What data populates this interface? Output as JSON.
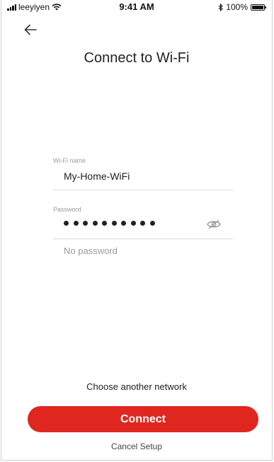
{
  "status_bar": {
    "carrier": "leeyiyen",
    "time": "9:41 AM",
    "battery": "100%",
    "icons": [
      "signal-icon",
      "wifi-icon",
      "bluetooth-icon",
      "battery-icon"
    ]
  },
  "header": {
    "back_icon": "arrow-left-icon",
    "title": "Connect to Wi-Fi"
  },
  "form": {
    "wifi_name_label": "Wi-Fi name",
    "wifi_name_value": "My-Home-WiFi",
    "password_label": "Password",
    "password_mask_count": 10,
    "password_toggle_icon": "eye-slash-icon",
    "no_password_link": "No password"
  },
  "footer": {
    "choose_network": "Choose another network",
    "connect_button": "Connect",
    "cancel_link": "Cancel Setup"
  },
  "colors": {
    "accent": "#e0271f",
    "muted_text": "#9a9a9a",
    "divider": "#dcdcdc"
  }
}
